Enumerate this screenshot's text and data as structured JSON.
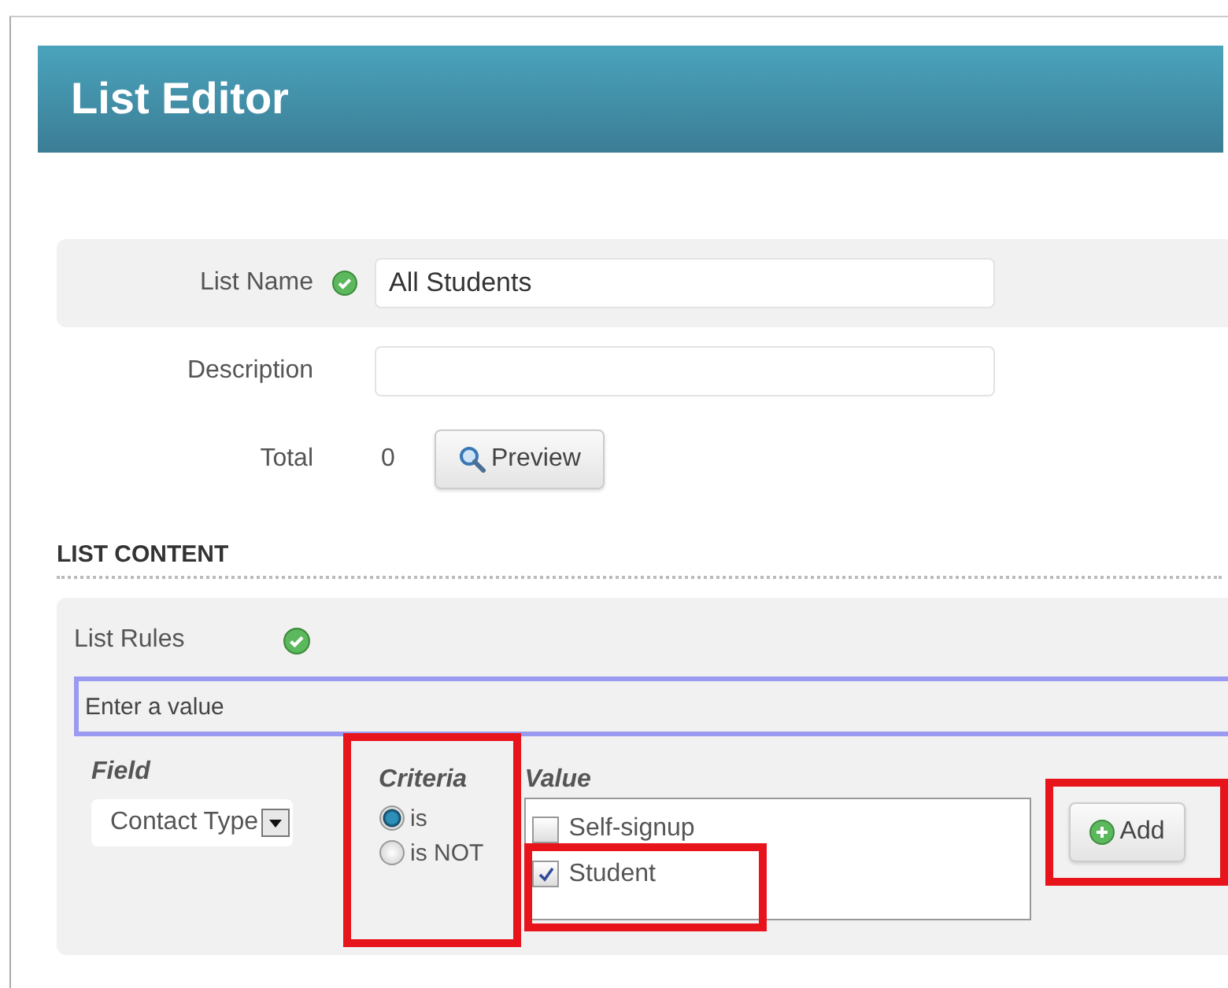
{
  "header": {
    "title": "List Editor"
  },
  "form": {
    "list_name": {
      "label": "List Name",
      "value": "All Students",
      "valid": true
    },
    "description": {
      "label": "Description"
    },
    "total": {
      "label": "Total",
      "value": "0"
    },
    "preview_button": "Preview"
  },
  "section_title": "LIST CONTENT",
  "rules": {
    "label": "List Rules",
    "valid": true,
    "value_field": {
      "placeholder": "Enter a value"
    },
    "field": {
      "heading": "Field",
      "value": "Contact Type"
    },
    "criteria": {
      "heading": "Criteria",
      "highlighted": true,
      "options": [
        {
          "label": "is",
          "selected": true
        },
        {
          "label": "is NOT",
          "selected": false
        }
      ]
    },
    "value": {
      "heading": "Value",
      "options": [
        {
          "label": "Self-signup",
          "checked": false,
          "highlighted": false
        },
        {
          "label": "Student",
          "checked": true,
          "highlighted": true
        }
      ]
    },
    "add_button": {
      "label": "Add",
      "highlighted": true
    }
  }
}
